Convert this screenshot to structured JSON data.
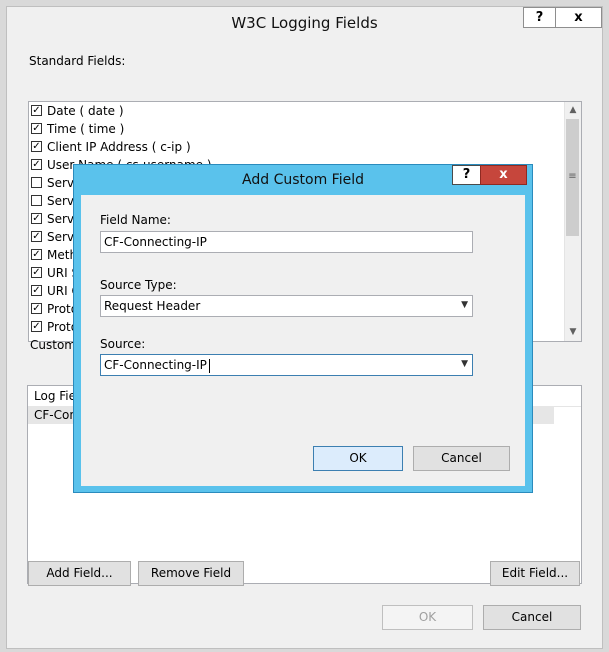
{
  "outer": {
    "title": "W3C Logging Fields",
    "help_label": "?",
    "close_label": "x",
    "standard_fields_label": "Standard Fields:",
    "custom_fields_label": "Custom",
    "standard_fields": [
      {
        "label": "Date ( date )",
        "checked": true
      },
      {
        "label": "Time ( time )",
        "checked": true
      },
      {
        "label": "Client IP Address ( c-ip )",
        "checked": true
      },
      {
        "label": "User Name ( cs-username )",
        "checked": true
      },
      {
        "label": "Service Name ( s-sitename )",
        "checked": false
      },
      {
        "label": "Serve",
        "checked": false
      },
      {
        "label": "Serve",
        "checked": true
      },
      {
        "label": "Serve",
        "checked": true
      },
      {
        "label": "Meth",
        "checked": true
      },
      {
        "label": "URI S",
        "checked": true
      },
      {
        "label": "URI C",
        "checked": true
      },
      {
        "label": "Proto",
        "checked": true
      },
      {
        "label": "Proto",
        "checked": true
      }
    ],
    "custom_list": {
      "header": "Log Fiel",
      "rows": [
        "CF-Con"
      ]
    },
    "buttons": {
      "add_field": "Add Field...",
      "remove_field": "Remove Field",
      "edit_field": "Edit Field...",
      "ok": "OK",
      "cancel": "Cancel"
    }
  },
  "dialog": {
    "title": "Add Custom Field",
    "help_label": "?",
    "close_label": "x",
    "field_name_label": "Field Name:",
    "field_name_value": "CF-Connecting-IP",
    "source_type_label": "Source Type:",
    "source_type_value": "Request Header",
    "source_label": "Source:",
    "source_value": "CF-Connecting-IP",
    "ok_label": "OK",
    "cancel_label": "Cancel"
  },
  "icons": {
    "check": "✓",
    "dropdown": "chevron-down-icon",
    "scroll_up": "scroll-up-icon",
    "scroll_down": "scroll-down-icon"
  }
}
